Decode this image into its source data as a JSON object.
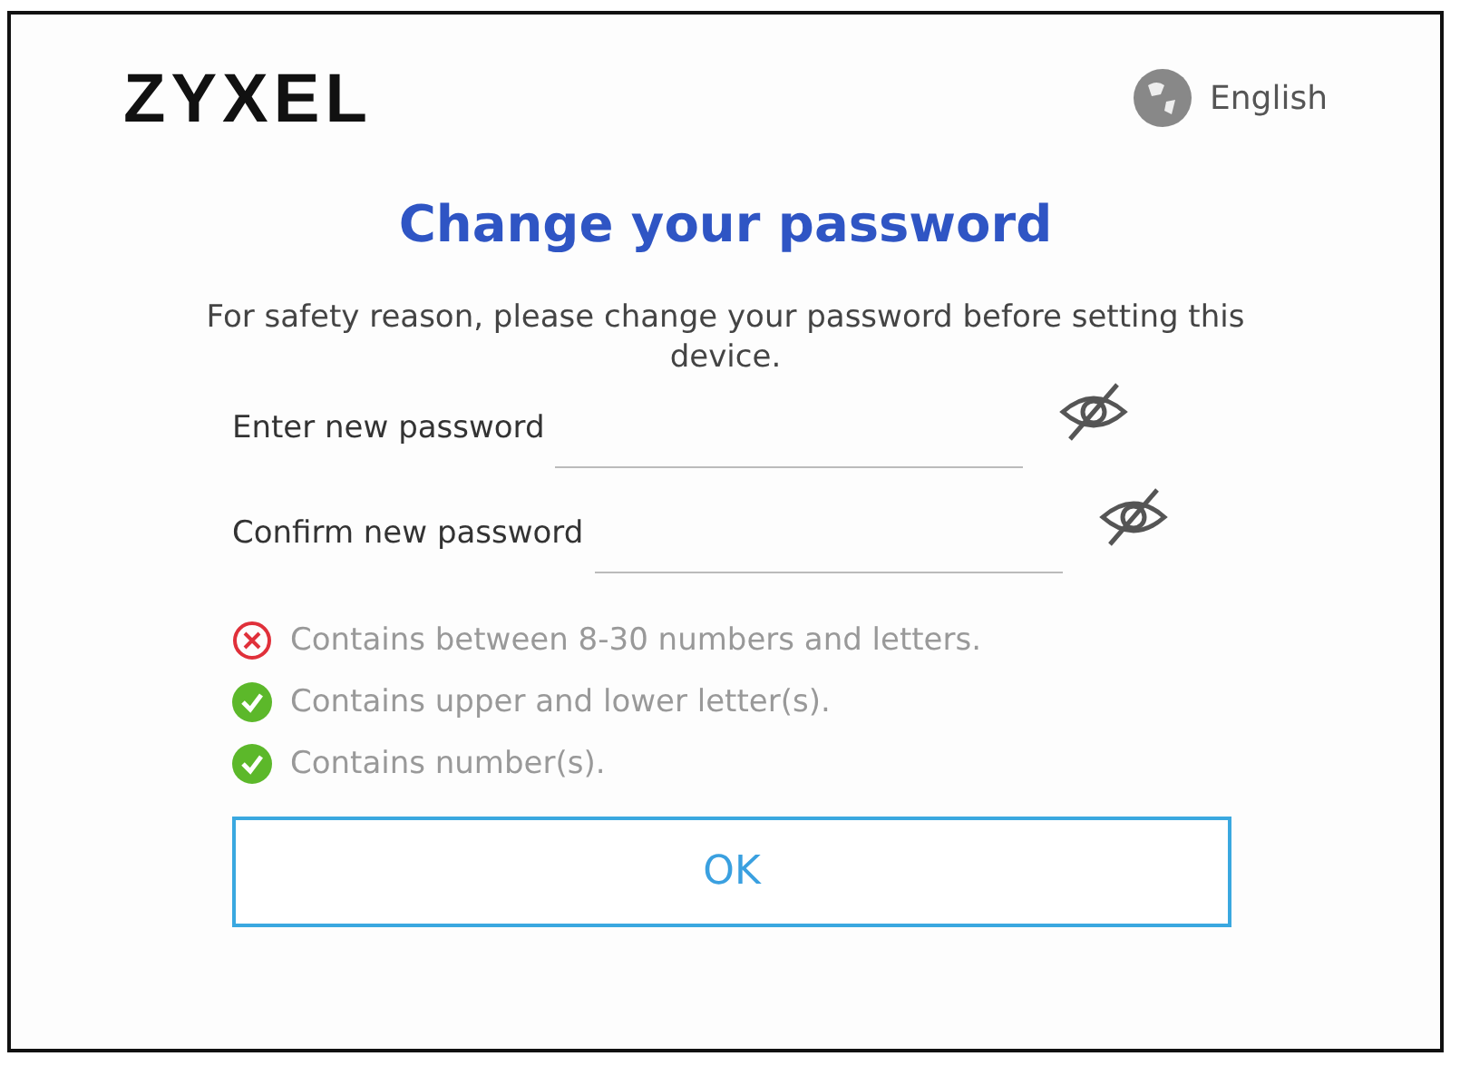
{
  "logo": "ZYXEL",
  "language": "English",
  "title": "Change your password",
  "message": "For safety reason, please change your password before setting this device.",
  "fields": [
    {
      "label": "Enter new password"
    },
    {
      "label": "Confirm new password"
    }
  ],
  "rules": [
    {
      "text": "Contains between 8-30 numbers and letters.",
      "met": false
    },
    {
      "text": "Contains upper and lower letter(s).",
      "met": true
    },
    {
      "text": "Contains number(s).",
      "met": true
    }
  ],
  "button": "OK"
}
